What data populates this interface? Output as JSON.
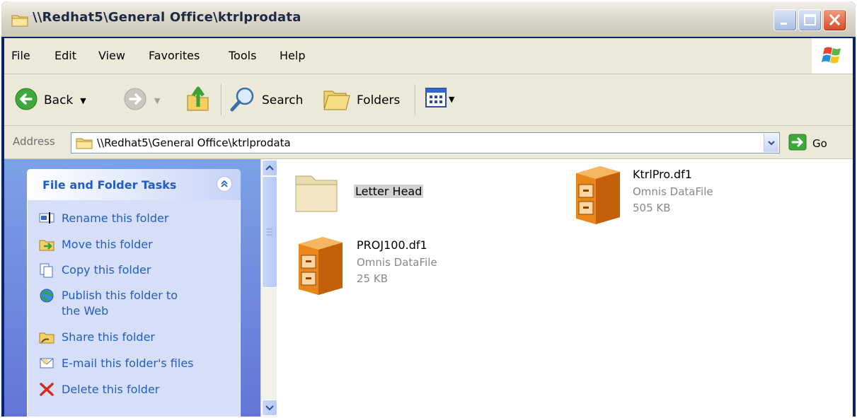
{
  "window": {
    "title": "\\\\Redhat5\\General Office\\ktrlprodata",
    "colors": {
      "title_text": "#1d2a45",
      "link": "#215dc6",
      "pane_gradient_top": "#7ba2e7",
      "pane_gradient_bottom": "#6375d6",
      "close": "#d94b2a"
    }
  },
  "menu": [
    "File",
    "Edit",
    "View",
    "Favorites",
    "Tools",
    "Help"
  ],
  "toolbar": {
    "back": "Back",
    "search": "Search",
    "folders": "Folders",
    "icons": [
      "back-arrow-icon",
      "forward-arrow-icon",
      "up-folder-icon",
      "search-icon",
      "folders-icon",
      "views-icon"
    ]
  },
  "address": {
    "label": "Address",
    "value": "\\\\Redhat5\\General Office\\ktrlprodata",
    "go": "Go"
  },
  "tasks": {
    "title": "File and Folder Tasks",
    "items": [
      {
        "label": "Rename this folder",
        "icon": "rename-icon"
      },
      {
        "label": "Move this folder",
        "icon": "move-icon"
      },
      {
        "label": "Copy this folder",
        "icon": "copy-icon"
      },
      {
        "label": "Publish this folder to",
        "label2": "the Web",
        "icon": "publish-web-icon"
      },
      {
        "label": "Share this folder",
        "icon": "share-icon"
      },
      {
        "label": "E-mail this folder's files",
        "icon": "email-icon"
      },
      {
        "label": "Delete this folder",
        "icon": "delete-icon"
      }
    ]
  },
  "files": [
    {
      "name": "Letter Head",
      "type": "",
      "size": "",
      "icon": "folder-icon",
      "selected": true
    },
    {
      "name": "KtrlPro.df1",
      "type": "Omnis DataFile",
      "size": "505 KB",
      "icon": "file-cabinet-icon"
    },
    {
      "name": "PROJ100.df1",
      "type": "Omnis DataFile",
      "size": "25 KB",
      "icon": "file-cabinet-icon"
    }
  ]
}
